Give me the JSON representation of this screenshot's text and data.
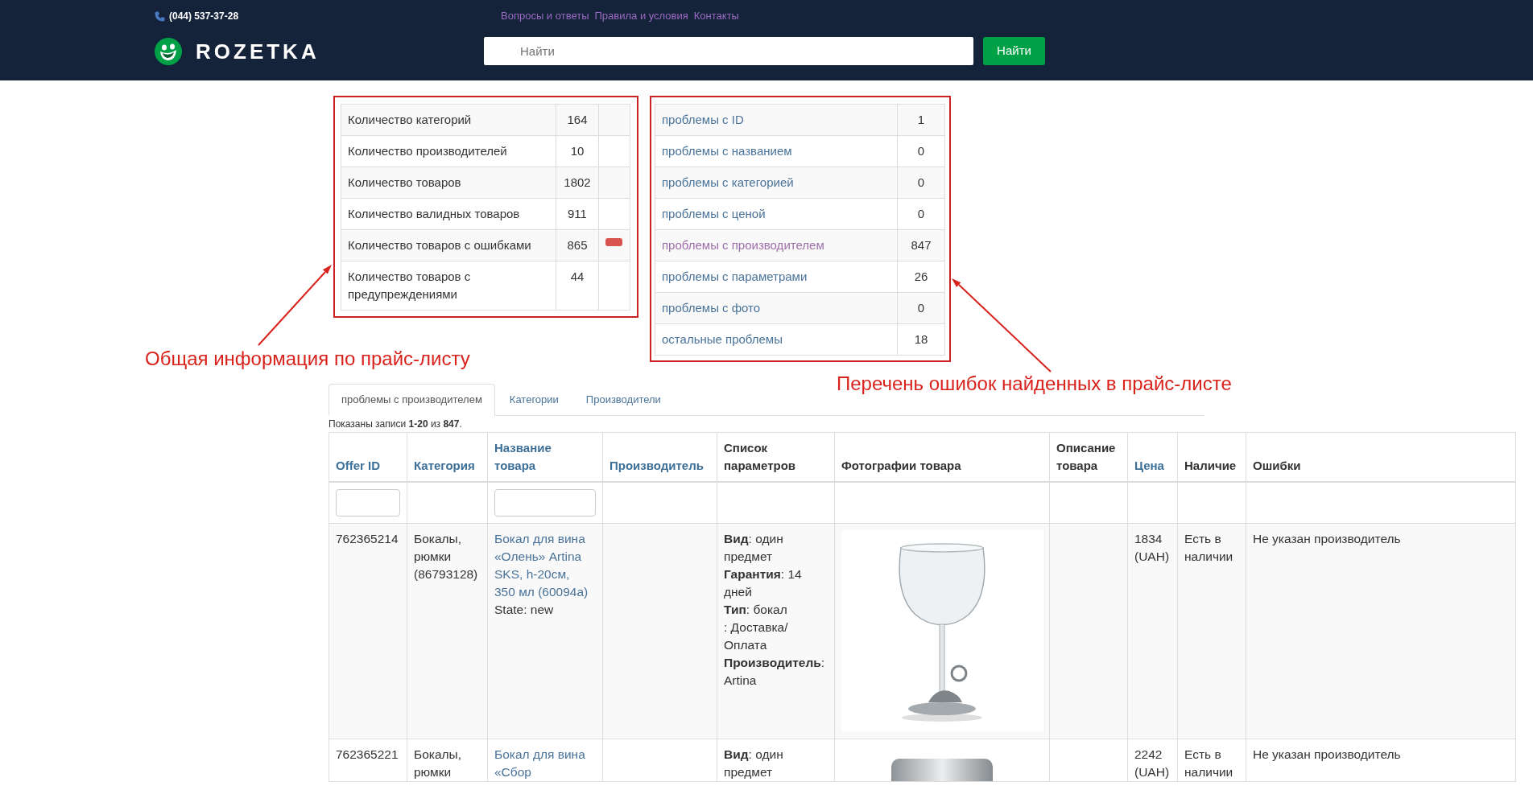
{
  "header": {
    "phone": "(044) 537-37-28",
    "links": [
      "Вопросы и ответы",
      "Правила и условия",
      "Контакты"
    ],
    "logo_text": "ROZETKA",
    "search": {
      "placeholder": "Найти"
    },
    "search_button": "Найти"
  },
  "summary": {
    "rows": [
      {
        "label": "Количество категорий",
        "value": "164",
        "flagged": false
      },
      {
        "label": "Количество производителей",
        "value": "10",
        "flagged": false
      },
      {
        "label": "Количество товаров",
        "value": "1802",
        "flagged": false
      },
      {
        "label": "Количество валидных товаров",
        "value": "911",
        "flagged": false
      },
      {
        "label": "Количество товаров с ошибками",
        "value": "865",
        "flagged": true
      },
      {
        "label": "Количество товаров с предупреждениями",
        "value": "44",
        "flagged": false
      }
    ]
  },
  "problems": {
    "rows": [
      {
        "label": "проблемы с ID",
        "count": "1",
        "visited": false
      },
      {
        "label": "проблемы с названием",
        "count": "0",
        "visited": false
      },
      {
        "label": "проблемы с категорией",
        "count": "0",
        "visited": false
      },
      {
        "label": "проблемы с ценой",
        "count": "0",
        "visited": false
      },
      {
        "label": "проблемы с производителем",
        "count": "847",
        "visited": true
      },
      {
        "label": "проблемы с параметрами",
        "count": "26",
        "visited": false
      },
      {
        "label": "проблемы с фото",
        "count": "0",
        "visited": false
      },
      {
        "label": "остальные проблемы",
        "count": "18",
        "visited": false
      }
    ]
  },
  "annotations": [
    {
      "text": "Общая информация по прайс-листу"
    },
    {
      "text": "Перечень ошибок найденных в прайс-листе"
    }
  ],
  "tabs": [
    {
      "label": "проблемы с производителем",
      "selected": true
    },
    {
      "label": "Категории",
      "selected": false
    },
    {
      "label": "Производители",
      "selected": false
    }
  ],
  "records_summary": "Показаны записи **1-20** из **847**.",
  "table": {
    "columns": [
      {
        "label": "Offer ID",
        "sortable": true,
        "filter": true
      },
      {
        "label": "Категория",
        "sortable": true,
        "filter": false
      },
      {
        "label": "Название товара",
        "sortable": true,
        "filter": true
      },
      {
        "label": "Производитель",
        "sortable": true,
        "filter": false
      },
      {
        "label": "Список параметров",
        "sortable": false,
        "filter": false
      },
      {
        "label": "Фотографии товара",
        "sortable": false,
        "filter": false
      },
      {
        "label": "Описание товара",
        "sortable": false,
        "filter": false
      },
      {
        "label": "Цена",
        "sortable": true,
        "filter": false
      },
      {
        "label": "Наличие",
        "sortable": false,
        "filter": false
      },
      {
        "label": "Ошибки",
        "sortable": false,
        "filter": false
      }
    ],
    "rows": [
      {
        "offer_id": "762365214",
        "category": "Бокалы, рюмки (86793128)",
        "name": "Бокал для вина «Олень» Artina SKS, h-20см, 350 мл (60094a)",
        "state": "State: new",
        "params": "**Вид**: один предмет\n**Гарантия**: 14 дней\n**Тип**: бокал\n: Доставка/Оплата\n**Производитель**: Artina",
        "price": "1834 (UAH)",
        "availability": "Есть в наличии",
        "errors": "Не указан производитель"
      },
      {
        "offer_id": "762365221",
        "category": "Бокалы, рюмки",
        "name": "Бокал для вина «Сбор",
        "params": "**Вид**: один предмет",
        "price": "2242 (UAH)",
        "availability": "Есть в наличии",
        "errors": "Не указан производитель"
      }
    ]
  }
}
